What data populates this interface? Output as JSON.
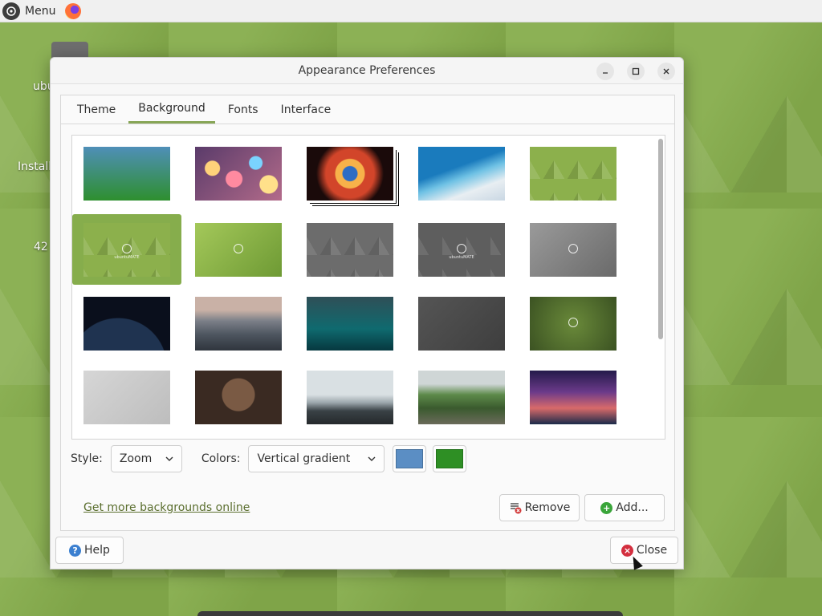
{
  "panel": {
    "menu_label": "Menu",
    "menu_icon": "ubuntu-mate-logo-icon",
    "browser_icon": "firefox-icon"
  },
  "desktop": {
    "labels": [
      "ubu",
      "Install",
      "42"
    ]
  },
  "dialog": {
    "title": "Appearance Preferences",
    "tabs": [
      {
        "label": "Theme",
        "active": false
      },
      {
        "label": "Background",
        "active": true
      },
      {
        "label": "Fonts",
        "active": false
      },
      {
        "label": "Interface",
        "active": false
      }
    ],
    "wallpapers": [
      {
        "name": "vertical-gradient",
        "colors": [
          "#4f8fb8",
          "#2e8f2e"
        ]
      },
      {
        "name": "bokeh-lights"
      },
      {
        "name": "helix-nebula"
      },
      {
        "name": "ocean-waves"
      },
      {
        "name": "green-geometric"
      },
      {
        "name": "ubuntu-mate-green-selected",
        "selected": true,
        "text": "ubuntuMATE"
      },
      {
        "name": "green-polygon-logo"
      },
      {
        "name": "gray-geometric"
      },
      {
        "name": "ubuntu-mate-gray",
        "text": "ubuntuMATE"
      },
      {
        "name": "gray-polygon-logo"
      },
      {
        "name": "earth-at-night"
      },
      {
        "name": "mountain-valley"
      },
      {
        "name": "rain-drops"
      },
      {
        "name": "dark-gray-plain"
      },
      {
        "name": "green-dark-logo"
      },
      {
        "name": "light-gray-plain"
      },
      {
        "name": "armored-warrior"
      },
      {
        "name": "misty-mountain"
      },
      {
        "name": "green-cliffs"
      },
      {
        "name": "milky-way-sky"
      }
    ],
    "style_label": "Style:",
    "style_value": "Zoom",
    "colors_label": "Colors:",
    "colors_value": "Vertical gradient",
    "primary_color": "#5b8ec4",
    "secondary_color": "#2e8f24",
    "link_text": "Get more backgrounds online",
    "remove_label": "Remove",
    "add_label": "Add...",
    "help_label": "Help",
    "close_label": "Close",
    "accent_color": "#87a556"
  }
}
